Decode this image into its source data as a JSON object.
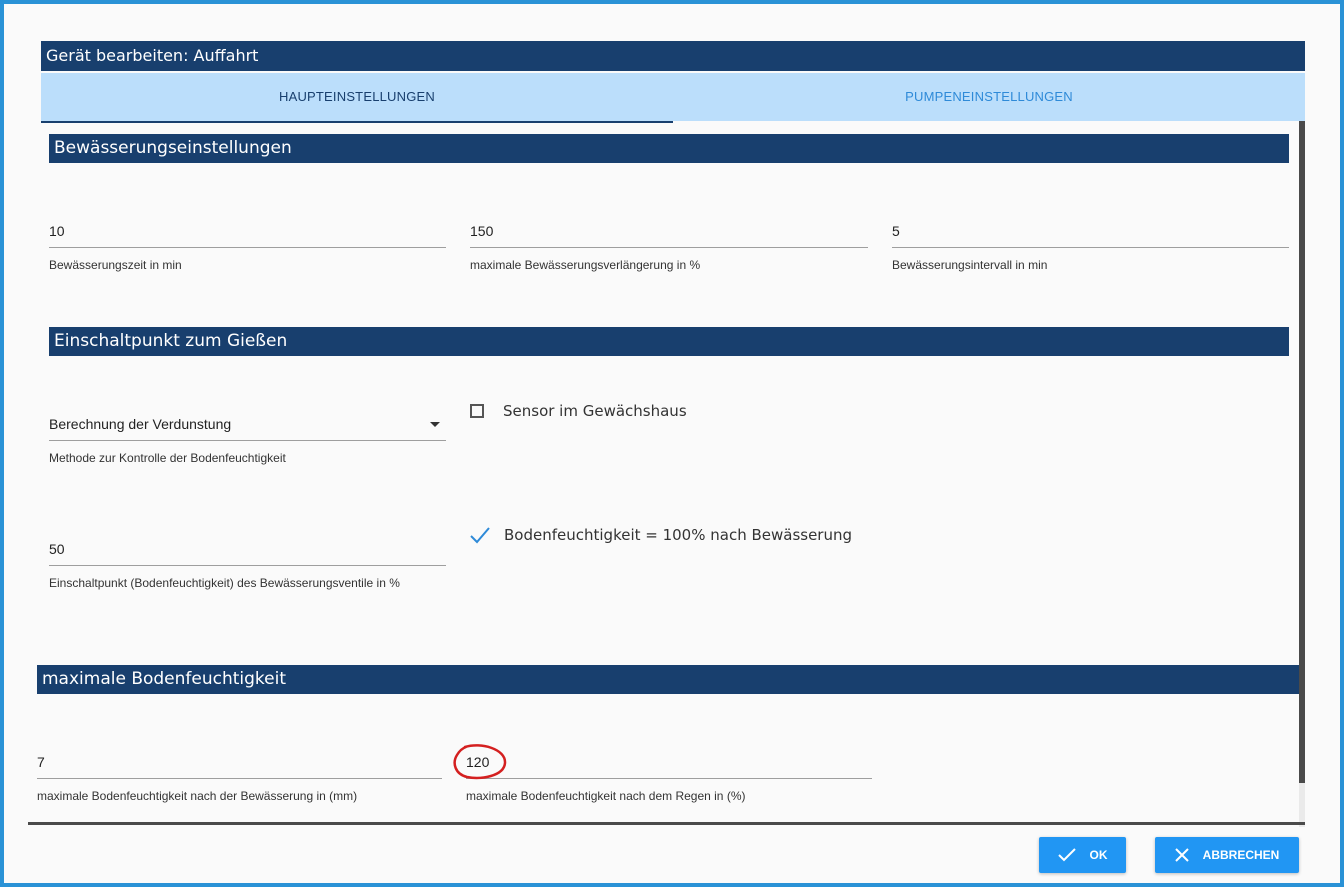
{
  "dialog": {
    "title": "Gerät bearbeiten: Auffahrt"
  },
  "tabs": [
    {
      "label": "HAUPTEINSTELLUNGEN",
      "active": true
    },
    {
      "label": "PUMPENEINSTELLUNGEN",
      "active": false
    }
  ],
  "section1": {
    "title": "Bewässerungseinstellungen",
    "fields": [
      {
        "value": "10",
        "helper": "Bewässerungszeit in min"
      },
      {
        "value": "150",
        "helper": "maximale Bewässerungsverlängerung in %"
      },
      {
        "value": "5",
        "helper": "Bewässerungsintervall in min"
      }
    ]
  },
  "section2": {
    "title": "Einschaltpunkt zum Gießen",
    "method_select": {
      "value": "Berechnung der Verdunstung",
      "helper": "Methode zur Kontrolle der Bodenfeuchtigkeit"
    },
    "sensor_checkbox": {
      "label": "Sensor im Gewächshaus",
      "checked": false
    },
    "threshold": {
      "value": "50",
      "helper": "Einschaltpunkt (Bodenfeuchtigkeit) des Bewässerungsventile in %"
    },
    "soil_checkbox": {
      "label": "Bodenfeuchtigkeit = 100% nach Bewässerung",
      "checked": true
    }
  },
  "section3": {
    "title": "maximale Bodenfeuchtigkeit",
    "fields": [
      {
        "value": "7",
        "helper": "maximale Bodenfeuchtigkeit nach der Bewässerung in (mm)"
      },
      {
        "value": "120",
        "helper": "maximale Bodenfeuchtigkeit nach dem Regen in (%)"
      }
    ]
  },
  "buttons": {
    "ok": "OK",
    "cancel": "ABBRECHEN"
  },
  "colors": {
    "header": "#183f6e",
    "tabs_bg": "#bbdefb",
    "accent": "#2196f3",
    "annotation": "#d42020"
  }
}
